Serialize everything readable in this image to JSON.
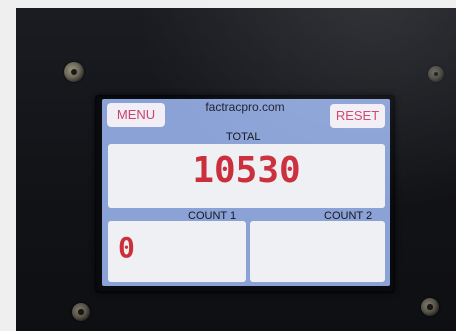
{
  "device": {
    "header": {
      "menu_label": "MENU",
      "website": "factracpro.com",
      "reset_label": "RESET"
    },
    "total": {
      "label": "TOTAL",
      "value": "10530"
    },
    "count1": {
      "label": "COUNT 1",
      "value": "0"
    },
    "count2": {
      "label": "COUNT 2",
      "value": ""
    }
  },
  "colors": {
    "screen_background": "#8aa2d6",
    "digit_red": "#cc2f3c",
    "button_text": "#c94468"
  }
}
